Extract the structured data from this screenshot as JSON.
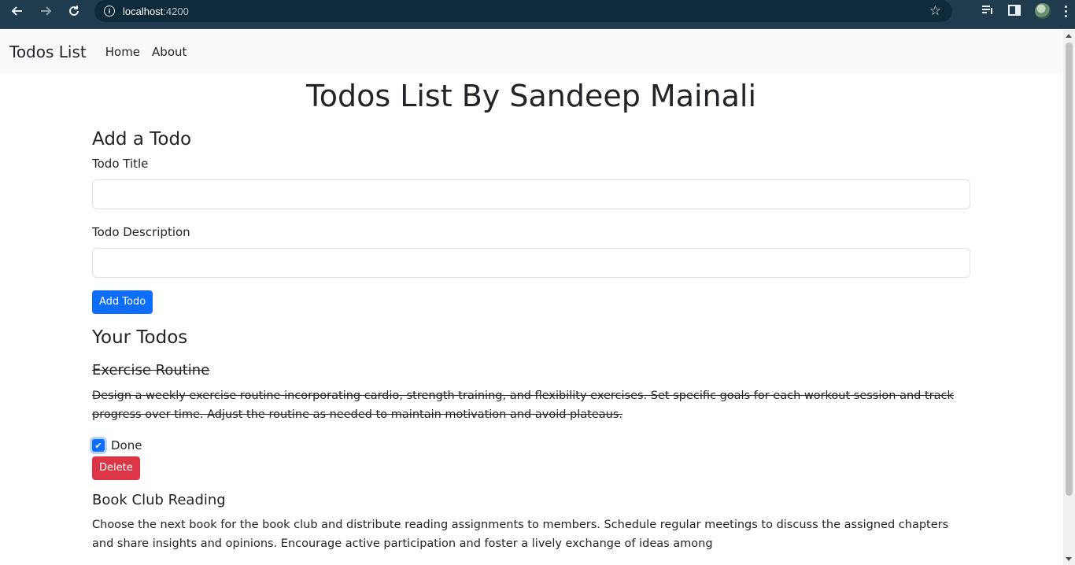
{
  "browser": {
    "host": "localhost",
    "port": ":4200"
  },
  "navbar": {
    "brand": "Todos List",
    "links": [
      "Home",
      "About"
    ]
  },
  "page": {
    "title": "Todos List By Sandeep Mainali"
  },
  "form": {
    "heading": "Add a Todo",
    "title_label": "Todo Title",
    "title_value": "",
    "description_label": "Todo Description",
    "description_value": "",
    "submit_label": "Add Todo"
  },
  "todos": {
    "heading": "Your Todos",
    "items": [
      {
        "title": "Exercise Routine",
        "description": "Design a weekly exercise routine incorporating cardio, strength training, and flexibility exercises. Set specific goals for each workout session and track progress over time. Adjust the routine as needed to maintain motivation and avoid plateaus.",
        "done": true,
        "done_label": "Done",
        "delete_label": "Delete"
      },
      {
        "title": "Book Club Reading",
        "description": "Choose the next book for the book club and distribute reading assignments to members. Schedule regular meetings to discuss the assigned chapters and share insights and opinions. Encourage active participation and foster a lively exchange of ideas among",
        "done": false
      }
    ]
  },
  "colors": {
    "primary": "#0d6efd",
    "danger": "#dc3545",
    "navbar_bg": "#f8f9fa",
    "chrome_bg": "#1f3b4d"
  }
}
